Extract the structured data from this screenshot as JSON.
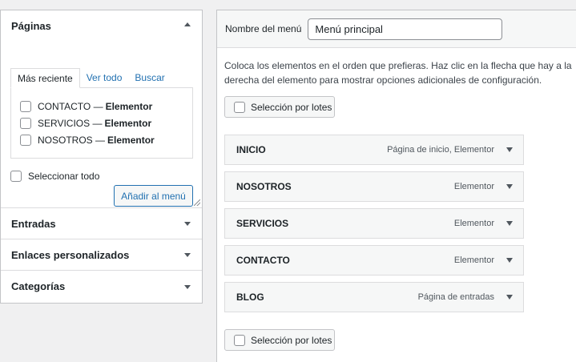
{
  "left_panel": {
    "pages": {
      "title": "Páginas",
      "tabs": [
        "Más reciente",
        "Ver todo",
        "Buscar"
      ],
      "items": [
        {
          "name": "CONTACTO",
          "sep": "—",
          "builder": "Elementor"
        },
        {
          "name": "SERVICIOS",
          "sep": "—",
          "builder": "Elementor"
        },
        {
          "name": "NOSOTROS",
          "sep": "—",
          "builder": "Elementor"
        }
      ],
      "select_all_label": "Seleccionar todo",
      "add_button_label": "Añadir al menú"
    },
    "sections": [
      {
        "title": "Entradas"
      },
      {
        "title": "Enlaces personalizados"
      },
      {
        "title": "Categorías"
      }
    ]
  },
  "menu_editor": {
    "name_label": "Nombre del menú",
    "name_value": "Menú principal",
    "instructions": "Coloca los elementos en el orden que prefieras. Haz clic en la flecha que hay a la derecha del elemento para mostrar opciones adicionales de configuración.",
    "bulk_select_label": "Selección por lotes",
    "items": [
      {
        "title": "INICIO",
        "type": "Página de inicio, Elementor"
      },
      {
        "title": "NOSOTROS",
        "type": "Elementor"
      },
      {
        "title": "SERVICIOS",
        "type": "Elementor"
      },
      {
        "title": "CONTACTO",
        "type": "Elementor"
      },
      {
        "title": "BLOG",
        "type": "Página de entradas"
      }
    ]
  },
  "colors": {
    "link": "#2271b1",
    "text": "#1d2327",
    "border": "#c3c4c7",
    "background": "#f0f0f1"
  }
}
